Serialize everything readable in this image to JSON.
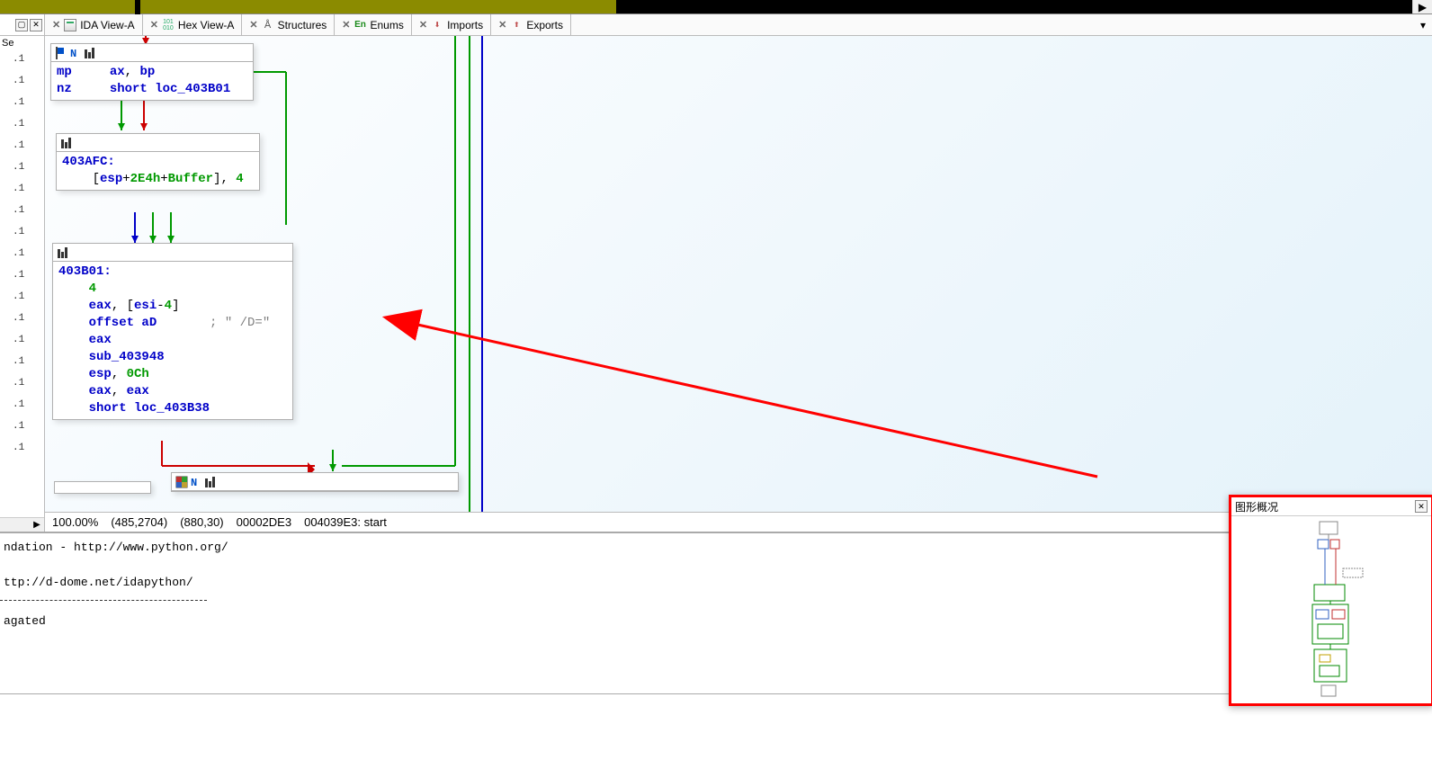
{
  "tabs": [
    {
      "label": "IDA View-A"
    },
    {
      "label": "Hex View-A"
    },
    {
      "label": "Structures"
    },
    {
      "label": "Enums"
    },
    {
      "label": "Imports"
    },
    {
      "label": "Exports"
    }
  ],
  "leftFilter": "Se",
  "nodes": {
    "n1": {
      "lines": [
        [
          {
            "t": "mp     ",
            "c": "blue"
          },
          {
            "t": "ax",
            "c": "blue"
          },
          {
            "t": ", ",
            "c": ""
          },
          {
            "t": "bp",
            "c": "blue"
          }
        ],
        [
          {
            "t": "nz     ",
            "c": "blue"
          },
          {
            "t": "short loc_403B01",
            "c": "blue"
          }
        ]
      ]
    },
    "n2": {
      "label": "403AFC:",
      "lines": [
        [
          {
            "t": "    [",
            "c": ""
          },
          {
            "t": "esp",
            "c": "blue"
          },
          {
            "t": "+",
            "c": ""
          },
          {
            "t": "2E4h",
            "c": "green"
          },
          {
            "t": "+",
            "c": ""
          },
          {
            "t": "Buffer",
            "c": "green"
          },
          {
            "t": "], ",
            "c": ""
          },
          {
            "t": "4",
            "c": "green"
          }
        ]
      ]
    },
    "n3": {
      "label": "403B01:",
      "lines": [
        [
          {
            "t": "    4",
            "c": "green"
          }
        ],
        [
          {
            "t": "    eax",
            "c": "blue"
          },
          {
            "t": ", [",
            "c": ""
          },
          {
            "t": "esi",
            "c": "blue"
          },
          {
            "t": "-",
            "c": ""
          },
          {
            "t": "4",
            "c": "green"
          },
          {
            "t": "]",
            "c": ""
          }
        ],
        [
          {
            "t": "    offset aD",
            "c": "blue"
          },
          {
            "t": "       ; \" /D=\"",
            "c": "gray"
          }
        ],
        [
          {
            "t": "    eax",
            "c": "blue"
          }
        ],
        [
          {
            "t": "    sub_403948",
            "c": "blue"
          }
        ],
        [
          {
            "t": "    esp",
            "c": "blue"
          },
          {
            "t": ", ",
            "c": ""
          },
          {
            "t": "0Ch",
            "c": "green"
          }
        ],
        [
          {
            "t": "    eax",
            "c": "blue"
          },
          {
            "t": ", ",
            "c": ""
          },
          {
            "t": "eax",
            "c": "blue"
          }
        ],
        [
          {
            "t": "    short loc_403B38",
            "c": "blue"
          }
        ]
      ]
    }
  },
  "status": {
    "zoom": "100.00%",
    "graphpos": "(485,2704)",
    "mousepos": "(880,30)",
    "fileoff": "00002DE3",
    "addr": "004039E3: start"
  },
  "output": {
    "l1": "ndation - http://www.python.org/",
    "l2": "ttp://d-dome.net/idapython/",
    "l3": "agated"
  },
  "overview": {
    "title": "图形概况"
  },
  "icons": {
    "close": "✕",
    "restore": "▢",
    "dropdown": "▾",
    "right": "▶"
  }
}
